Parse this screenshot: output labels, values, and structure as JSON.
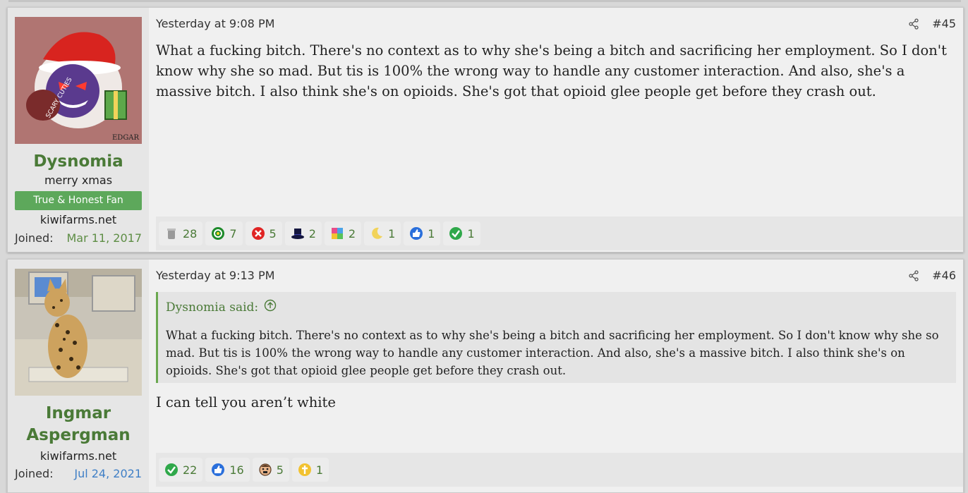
{
  "posts": [
    {
      "username": "Dysnomia",
      "user_title": "merry xmas",
      "banner": "True & Honest Fan",
      "site": "kiwifarms.net",
      "joined_label": "Joined:",
      "joined": "Mar 11, 2017",
      "avatar_signature": "EDGAR",
      "avatar_badge_text": "SCARY CUTIES",
      "date": "Yesterday at 9:08 PM",
      "post_number": "#45",
      "body": "What a fucking bitch. There's no context as to why she's being a bitch and sacrificing her employment. So I don't know why she so mad. But tis is 100% the wrong way to handle any customer interaction. And also, she's a massive bitch. I also think she's on opioids. She's got that opioid glee people get before they crash out.",
      "reactions": [
        {
          "icon": "trash-can-icon",
          "count": "28"
        },
        {
          "icon": "autistic-icon",
          "count": "7"
        },
        {
          "icon": "disagree-icon",
          "count": "5"
        },
        {
          "icon": "top-hat-icon",
          "count": "2"
        },
        {
          "icon": "puzzle-icon",
          "count": "2"
        },
        {
          "icon": "moon-icon",
          "count": "1"
        },
        {
          "icon": "thumbs-up-icon",
          "count": "1"
        },
        {
          "icon": "agree-check-icon",
          "count": "1"
        }
      ]
    },
    {
      "username": "Ingmar Aspergman",
      "site": "kiwifarms.net",
      "joined_label": "Joined:",
      "joined": "Jul 24, 2021",
      "date": "Yesterday at 9:13 PM",
      "post_number": "#46",
      "quote_author": "Dysnomia said:",
      "quote_text": "What a fucking bitch. There's no context as to why she's being a bitch and sacrificing her employment. So I don't know why she so mad. But tis is 100% the wrong way to handle any customer interaction. And also, she's a massive bitch. I also think she's on opioids. She's got that opioid glee people get before they crash out.",
      "body": "I can tell you aren’t white",
      "reactions": [
        {
          "icon": "agree-check-icon",
          "count": "22"
        },
        {
          "icon": "thumbs-up-icon",
          "count": "16"
        },
        {
          "icon": "face-icon",
          "count": "5"
        },
        {
          "icon": "cross-icon",
          "count": "1"
        }
      ]
    }
  ],
  "colors": {
    "username": "#4a7a37",
    "joined_post1": "#5d8d44",
    "joined_post2": "#3f7fc6",
    "banner": "#5da85b"
  }
}
